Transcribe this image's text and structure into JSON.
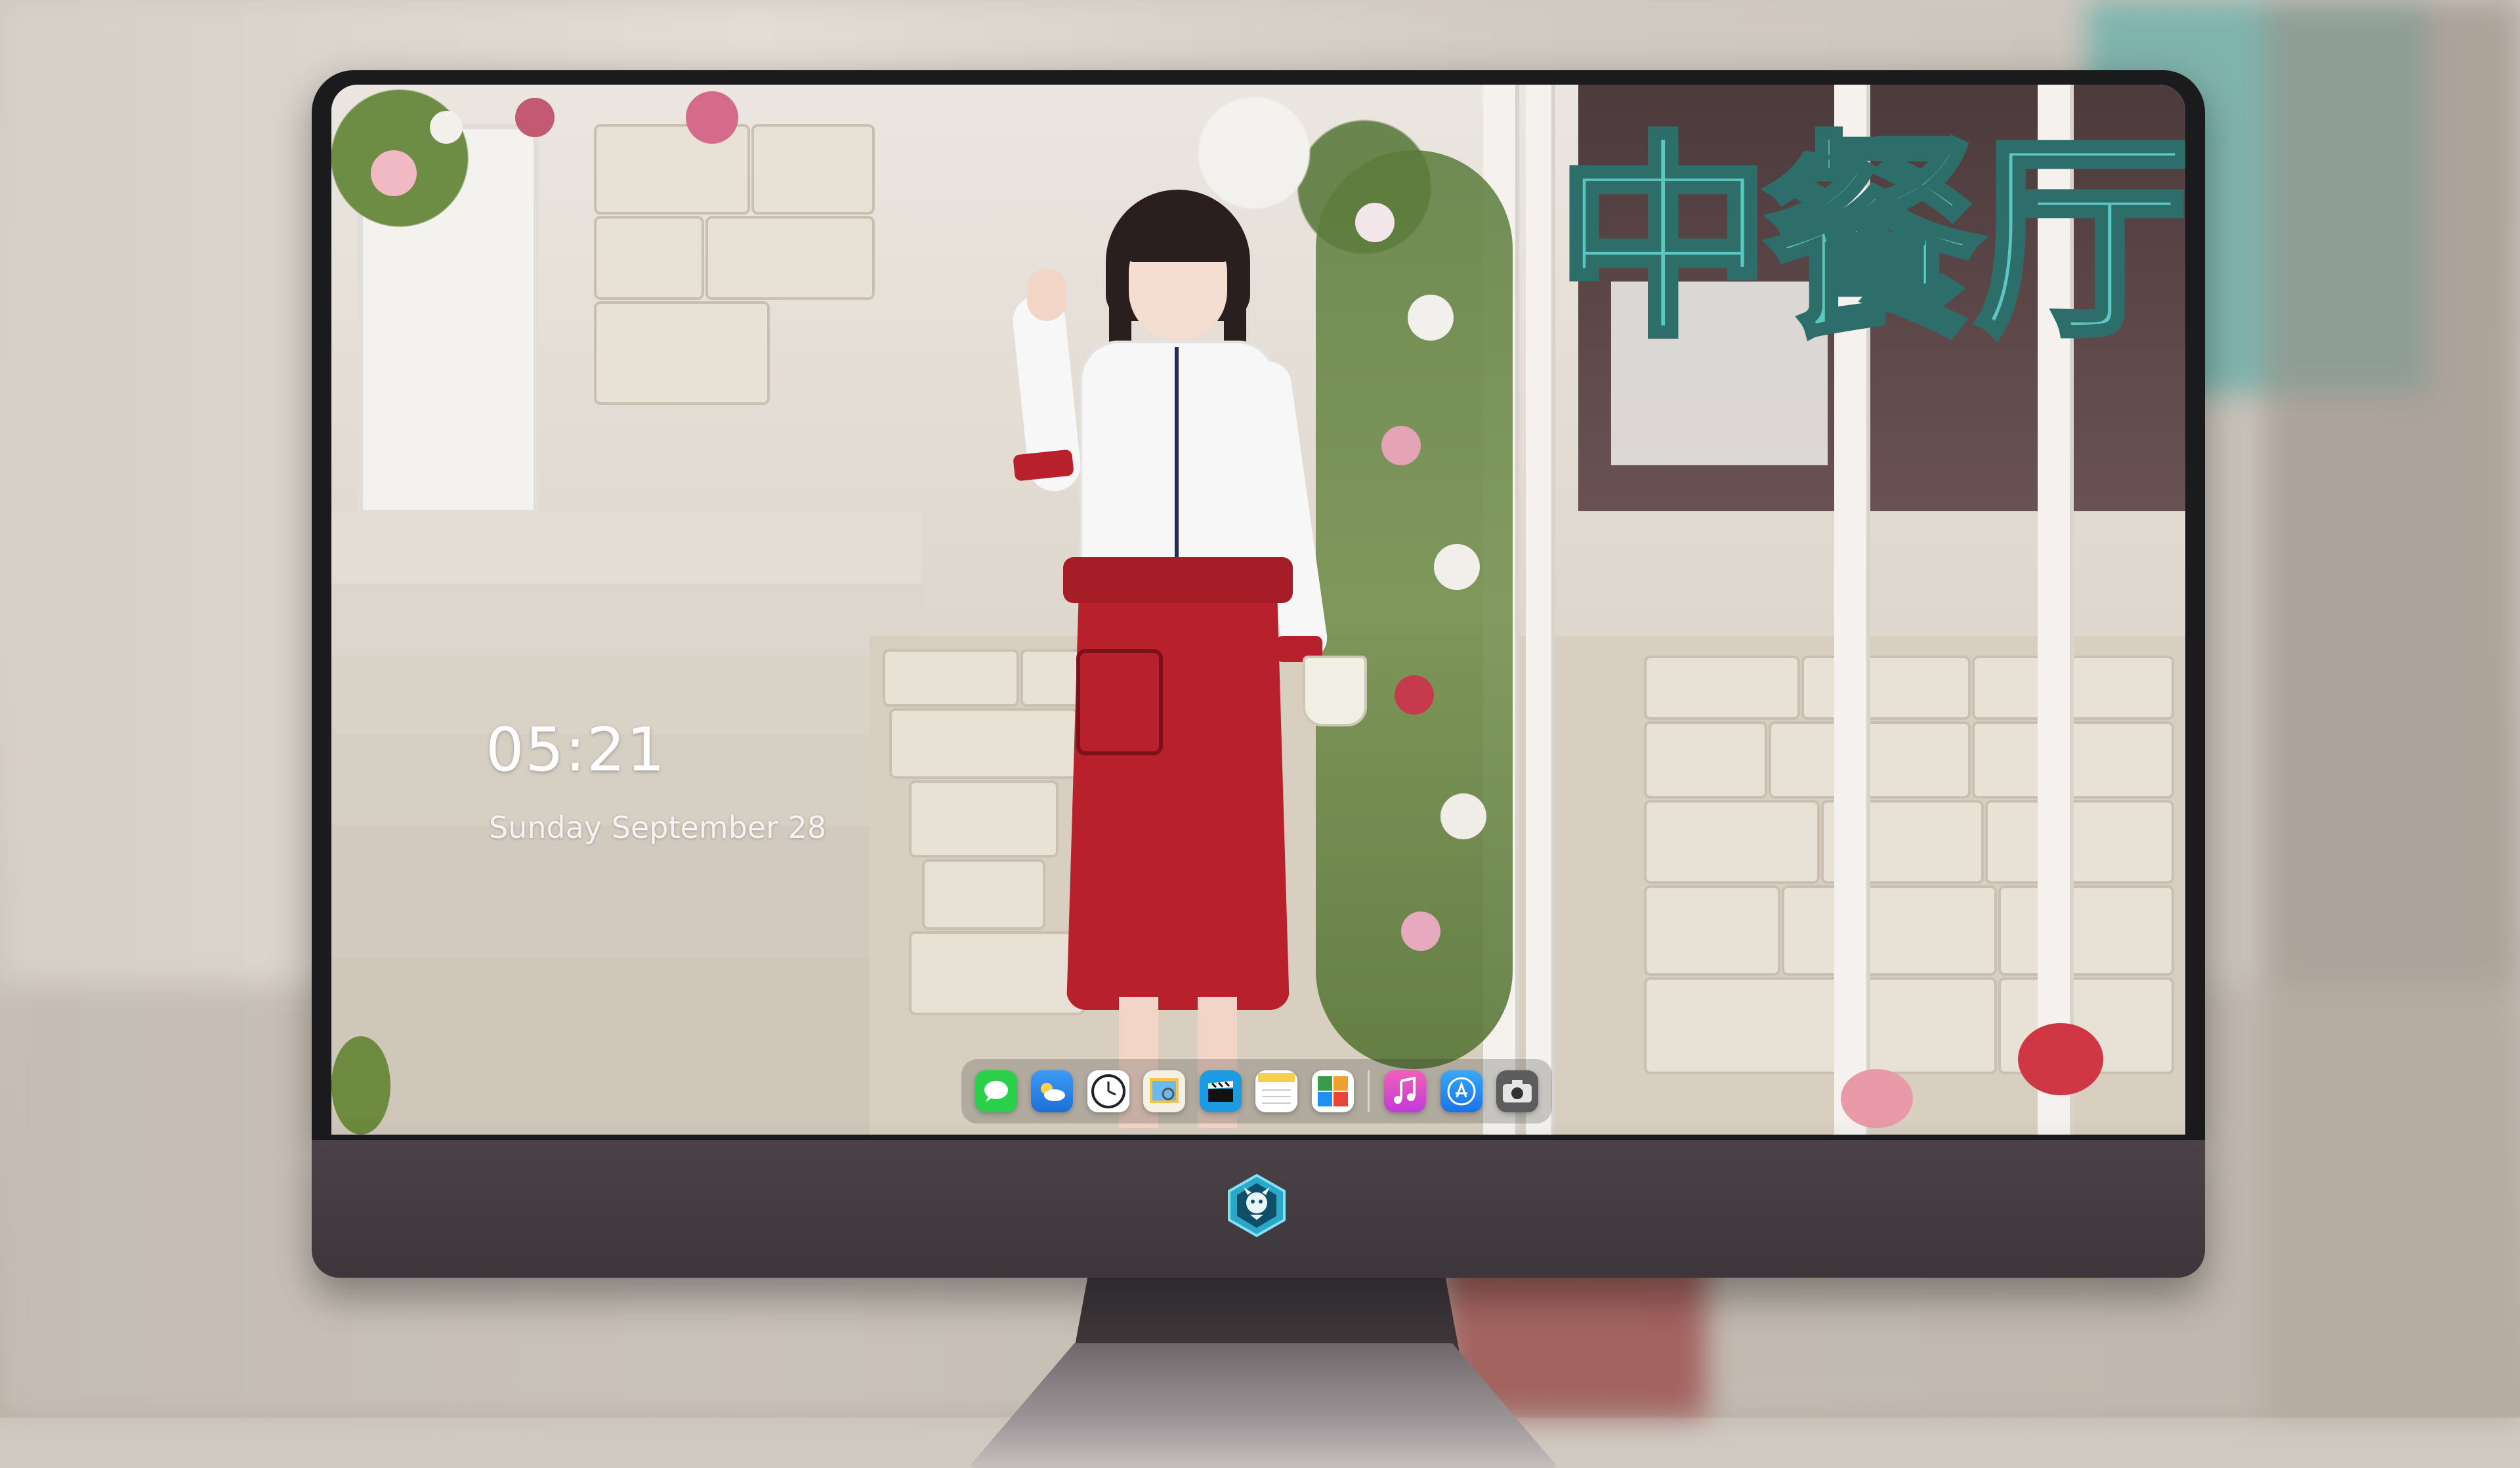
{
  "lockscreen": {
    "time": "05:21",
    "date": "Sunday September  28"
  },
  "wallpaper": {
    "title_text": "中餐厅"
  },
  "dock": {
    "apps": [
      {
        "name": "messages-icon",
        "color": "#2bd04a"
      },
      {
        "name": "weather-icon",
        "color": "#2e8ff0"
      },
      {
        "name": "clock-icon",
        "color": "#ffffff"
      },
      {
        "name": "preview-icon",
        "color": "#f4c542"
      },
      {
        "name": "claquette-icon",
        "color": "#1c9be0"
      },
      {
        "name": "notes-icon",
        "color": "#f7d04a"
      },
      {
        "name": "photo-booth-icon",
        "color": "#3b9a4c"
      },
      {
        "name": "music-icon",
        "color": "#e844b0"
      },
      {
        "name": "app-store-icon",
        "color": "#1f8ef5"
      },
      {
        "name": "camera-icon",
        "color": "#6d6d6d"
      }
    ]
  },
  "colors": {
    "chin": "#3f383c",
    "accent_teal": "#5cc7c1",
    "skirt_red": "#b8202c"
  }
}
